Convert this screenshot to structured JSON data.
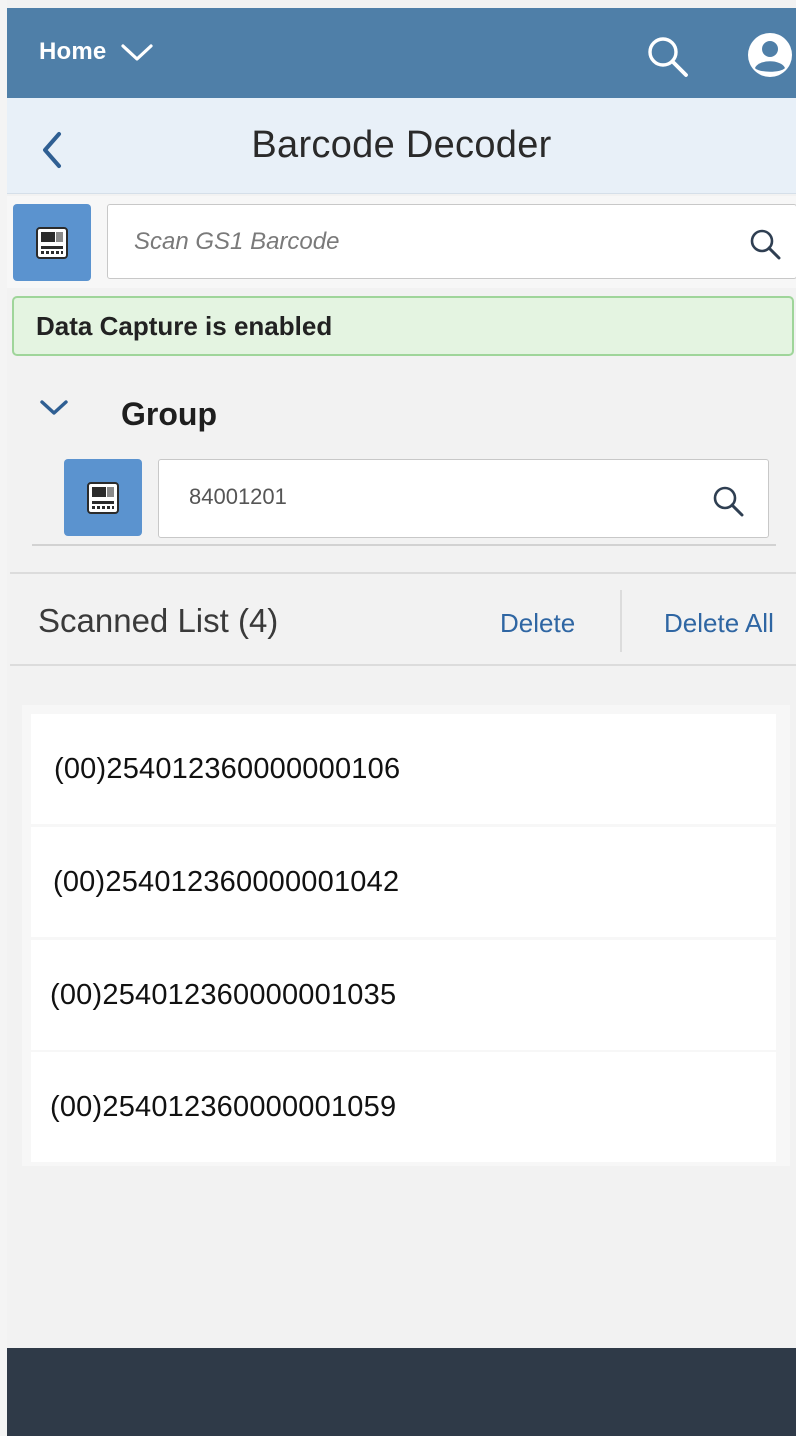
{
  "shell": {
    "home_label": "Home",
    "home_icon": "chevron-down-icon",
    "search_icon": "search-icon",
    "user_icon": "user-avatar-icon",
    "bar_color": "#4f7fa8"
  },
  "page": {
    "title": "Barcode Decoder",
    "back_icon": "chevron-left-icon"
  },
  "scan": {
    "placeholder": "Scan GS1 Barcode",
    "value": "",
    "scan_icon": "barcode-scanner-icon",
    "search_icon": "search-icon",
    "button_color": "#5b93cf"
  },
  "message": {
    "text": "Data Capture is enabled",
    "type": "success"
  },
  "group": {
    "title": "Group",
    "expanded": true,
    "input_value": "84001201"
  },
  "scanned_list": {
    "title": "Scanned List (4)",
    "delete_label": "Delete",
    "delete_all_label": "Delete All",
    "items": [
      "(00)254012360000000106",
      "(00)254012360000001042",
      "(00)254012360000001035",
      "(00)254012360000001059"
    ]
  }
}
